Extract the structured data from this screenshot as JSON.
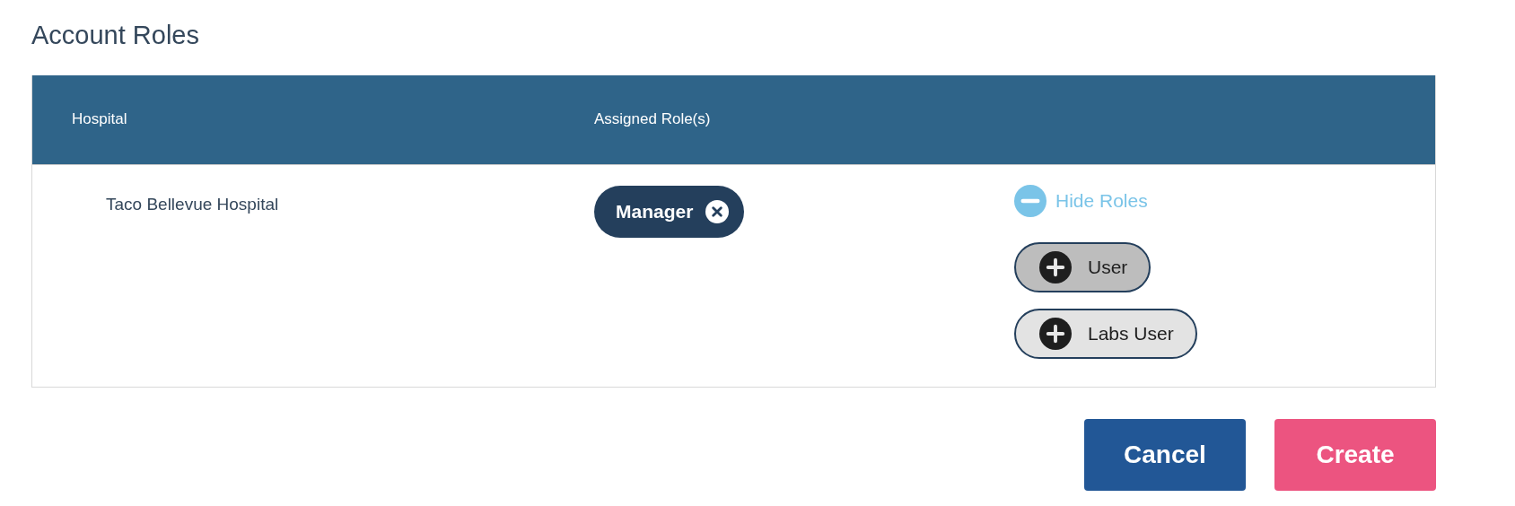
{
  "title": "Account Roles",
  "table": {
    "columns": [
      "Hospital",
      "Assigned Role(s)"
    ],
    "rows": [
      {
        "hospital": "Taco Bellevue Hospital",
        "assigned_roles": [
          "Manager"
        ],
        "toggle": {
          "label": "Hide Roles",
          "expanded": true
        },
        "available_roles": [
          {
            "label": "User",
            "highlighted": true
          },
          {
            "label": "Labs User",
            "highlighted": false
          }
        ]
      }
    ]
  },
  "buttons": [
    {
      "label": "Cancel",
      "kind": "secondary"
    },
    {
      "label": "Create",
      "kind": "primary"
    }
  ]
}
